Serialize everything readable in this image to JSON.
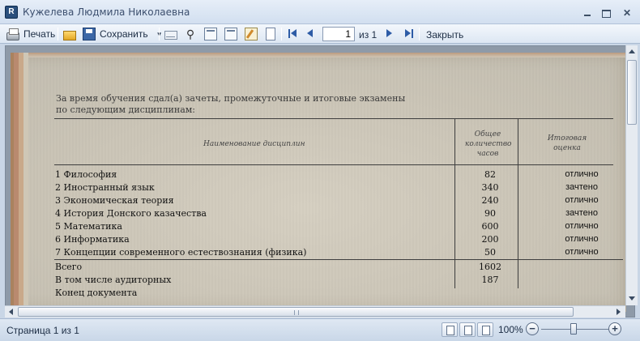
{
  "window": {
    "title": "Кужелева Людмила Николаевна",
    "app_icon": "report-app-icon"
  },
  "toolbar": {
    "print_label": "Печать",
    "save_label": "Сохранить",
    "page_value": "1",
    "page_of": "из 1",
    "close_label": "Закрыть",
    "icons": [
      "printer-icon",
      "open-folder-icon",
      "save-disk-icon",
      "email-icon",
      "find-icon",
      "document-map-icon",
      "parameters-icon",
      "edit-icon",
      "page-setup-icon"
    ]
  },
  "document": {
    "intro_line1": "За время обучения сдал(а) зачеты, промежуточные и итоговые экзамены",
    "intro_line2": "по следующим дисциплинам:",
    "headers": {
      "name": "Наименование дисциплин",
      "hours": "Общее количество часов",
      "grade": "Итоговая оценка"
    },
    "rows": [
      {
        "name": "1 Философия",
        "hours": "82",
        "grade": "отлично"
      },
      {
        "name": "2 Иностранный язык",
        "hours": "340",
        "grade": "зачтено"
      },
      {
        "name": "3 Экономическая теория",
        "hours": "240",
        "grade": "отлично"
      },
      {
        "name": "4 История Донского казачества",
        "hours": "90",
        "grade": "зачтено"
      },
      {
        "name": "5 Математика",
        "hours": "600",
        "grade": "отлично"
      },
      {
        "name": "6 Информатика",
        "hours": "200",
        "grade": "отлично"
      },
      {
        "name": "7 Концепции современного естествознания (физика)",
        "hours": "50",
        "grade": "отлично"
      }
    ],
    "total_label": "Всего",
    "total_hours": "1602",
    "classroom_label": "В том числе аудиторных",
    "classroom_hours": "187",
    "end_label": "Конец документа"
  },
  "statusbar": {
    "page_status": "Страница 1 из 1",
    "zoom": "100%",
    "zoom_minus": "−",
    "zoom_plus": "+"
  }
}
